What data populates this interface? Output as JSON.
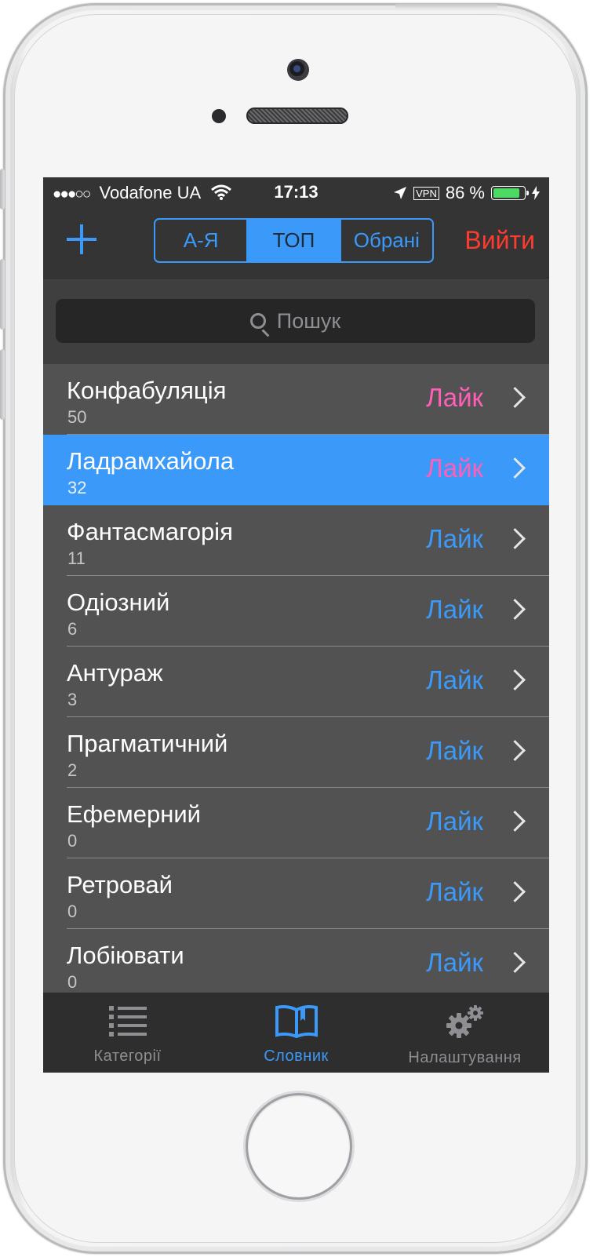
{
  "status": {
    "carrier": "Vodafone UA",
    "time": "17:13",
    "vpn": "VPN",
    "battery": "86 %"
  },
  "nav": {
    "segments": [
      "А-Я",
      "ТОП",
      "Обрані"
    ],
    "active_segment": "ТОП",
    "logout_label": "Вийти"
  },
  "search": {
    "placeholder": "Пошук"
  },
  "list": {
    "items": [
      {
        "word": "Конфабуляція",
        "count": "50",
        "like": "Лайк",
        "liked": true
      },
      {
        "word": "Ладрамхайола",
        "count": "32",
        "like": "Лайк",
        "liked": true,
        "selected": true
      },
      {
        "word": "Фантасмагорія",
        "count": "11",
        "like": "Лайк",
        "liked": false
      },
      {
        "word": "Одіозний",
        "count": "6",
        "like": "Лайк",
        "liked": false
      },
      {
        "word": "Антураж",
        "count": "3",
        "like": "Лайк",
        "liked": false
      },
      {
        "word": "Прагматичний",
        "count": "2",
        "like": "Лайк",
        "liked": false
      },
      {
        "word": "Ефемерний",
        "count": "0",
        "like": "Лайк",
        "liked": false
      },
      {
        "word": "Ретровай",
        "count": "0",
        "like": "Лайк",
        "liked": false
      },
      {
        "word": "Лобіювати",
        "count": "0",
        "like": "Лайк",
        "liked": false
      }
    ]
  },
  "tabs": [
    {
      "label": "Категорії",
      "icon": "list-icon"
    },
    {
      "label": "Словник",
      "icon": "book-icon",
      "active": true
    },
    {
      "label": "Налаштування",
      "icon": "gears-icon"
    }
  ],
  "colors": {
    "accent": "#3b9af9",
    "logout": "#ff3b2f",
    "liked": "#ff5fb8",
    "battery": "#4cd964"
  }
}
